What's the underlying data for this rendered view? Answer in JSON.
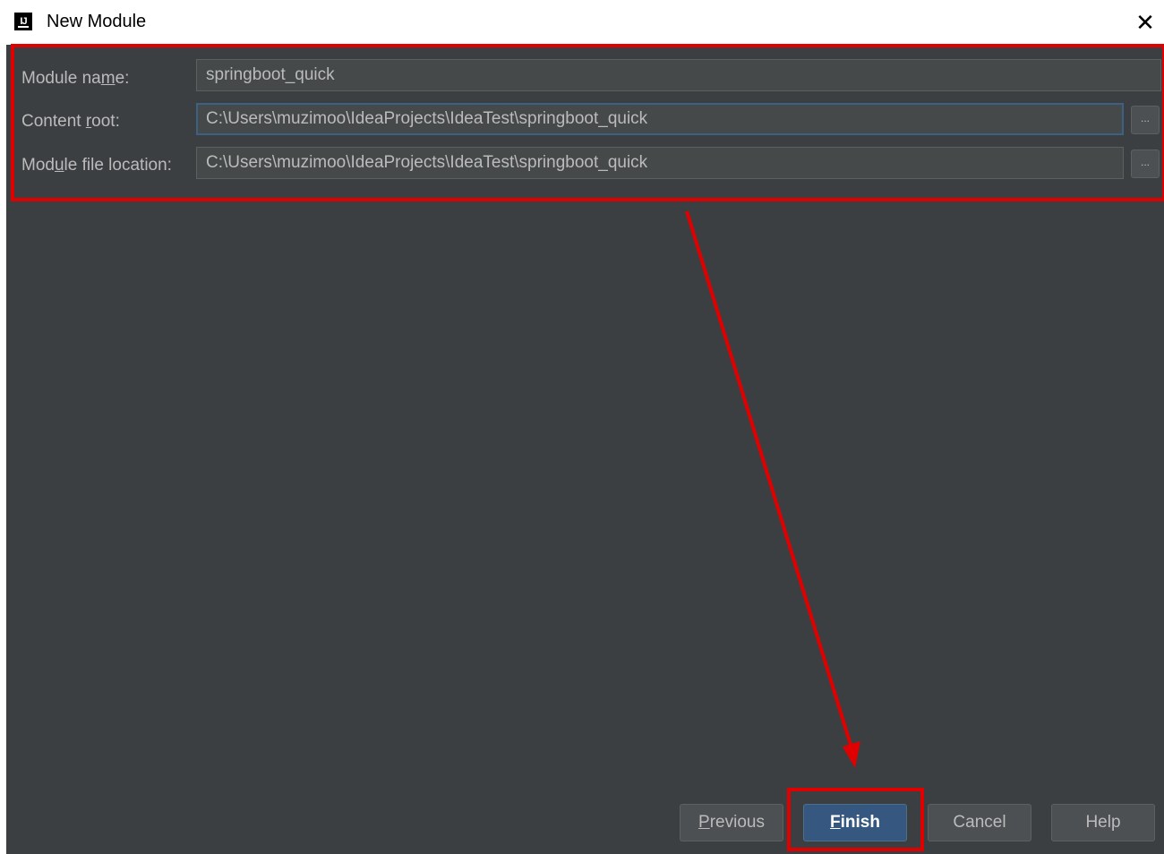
{
  "window": {
    "title": "New Module",
    "app_icon": "intellij-idea-icon",
    "app_icon_text": "IJ",
    "close_icon": "close-icon",
    "close_glyph": "✕"
  },
  "form": {
    "module_name": {
      "label_pre": "Module na",
      "label_mnemonic": "m",
      "label_post": "e:",
      "value": "springboot_quick"
    },
    "content_root": {
      "label_pre": "Content ",
      "label_mnemonic": "r",
      "label_post": "oot:",
      "value": "C:\\Users\\muzimoo\\IdeaProjects\\IdeaTest\\springboot_quick",
      "browse_label": "..."
    },
    "module_file_location": {
      "label_pre": "Mod",
      "label_mnemonic": "u",
      "label_post": "le file location:",
      "value": "C:\\Users\\muzimoo\\IdeaProjects\\IdeaTest\\springboot_quick",
      "browse_label": "..."
    }
  },
  "buttons": {
    "previous": {
      "mnemonic": "P",
      "rest": "revious"
    },
    "finish": {
      "mnemonic": "F",
      "rest": "inish"
    },
    "cancel": "Cancel",
    "help": "Help"
  },
  "colors": {
    "panel_background": "#3c3f41",
    "field_background": "#45494a",
    "text": "#bbbbbb",
    "primary_button": "#365880",
    "annotation_red": "#e00000"
  }
}
